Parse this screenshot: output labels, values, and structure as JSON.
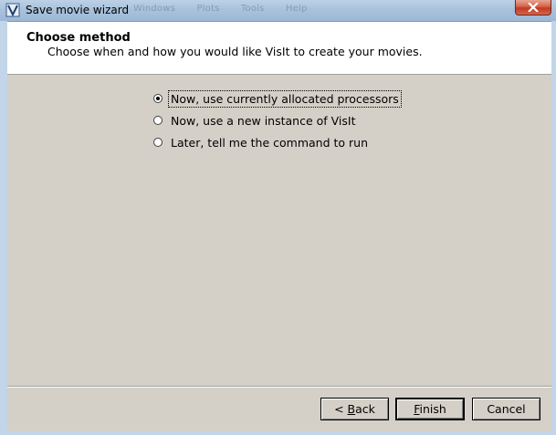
{
  "window": {
    "title": "Save movie wizard",
    "background_menu_ghost": [
      "Windows",
      "Plots",
      "Tools",
      "Help"
    ]
  },
  "header": {
    "title": "Choose method",
    "subtitle": "Choose when and how you would like VisIt to create your movies."
  },
  "options": [
    {
      "label": "Now, use currently allocated processors",
      "checked": true,
      "focused": true
    },
    {
      "label": "Now, use a new instance of VisIt",
      "checked": false,
      "focused": false
    },
    {
      "label": "Later, tell me the command to run",
      "checked": false,
      "focused": false
    }
  ],
  "buttons": {
    "back": {
      "mnemonic": "B",
      "prefix": "< ",
      "rest": "ack"
    },
    "finish": {
      "mnemonic": "F",
      "rest": "inish"
    },
    "cancel": "Cancel"
  },
  "icons": {
    "app": "visit-app-icon",
    "close": "close-icon"
  }
}
